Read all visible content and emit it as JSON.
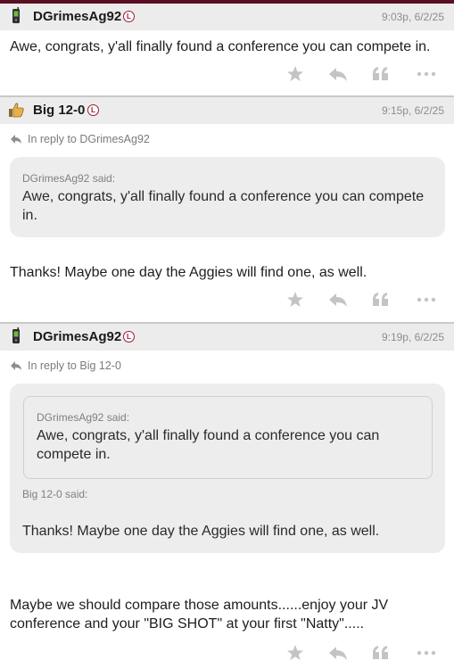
{
  "colors": {
    "accent_bar": "#5b0f23",
    "badge": "#9a1b2f",
    "header_bg": "#ececec",
    "quote_bg": "#ededed",
    "action_icon": "#c4c4c4"
  },
  "posts": [
    {
      "username": "DGrimesAg92",
      "avatar_icon": "phone-icon",
      "badge": "L",
      "timestamp": "9:03p, 6/2/25",
      "body": "Awe, congrats, y'all finally found a conference you can compete in.",
      "actions": [
        "star-icon",
        "reply-icon",
        "quote-icon",
        "more-icon"
      ]
    },
    {
      "username": "Big 12-0",
      "avatar_icon": "thumbs-up-icon",
      "badge": "L",
      "timestamp": "9:15p, 6/2/25",
      "reply_to": "In reply to DGrimesAg92",
      "quote": {
        "attribution": "DGrimesAg92 said:",
        "text": "Awe, congrats, y'all finally found a conference you can compete in."
      },
      "body": "Thanks! Maybe one day the Aggies will find one, as well.",
      "actions": [
        "star-icon",
        "reply-icon",
        "quote-icon",
        "more-icon"
      ]
    },
    {
      "username": "DGrimesAg92",
      "avatar_icon": "phone-icon",
      "badge": "L",
      "timestamp": "9:19p, 6/2/25",
      "reply_to": "In reply to Big 12-0",
      "quote": {
        "nested": {
          "attribution": "DGrimesAg92 said:",
          "text": "Awe, congrats, y'all finally found a conference you can compete in."
        },
        "attribution": "Big 12-0 said:",
        "text": "Thanks! Maybe one day the Aggies will find one, as well."
      },
      "body": "Maybe we should compare those amounts......enjoy your JV conference and your \"BIG SHOT\" at your first \"Natty\".....",
      "actions": [
        "star-icon",
        "reply-icon",
        "quote-icon",
        "more-icon"
      ]
    }
  ]
}
